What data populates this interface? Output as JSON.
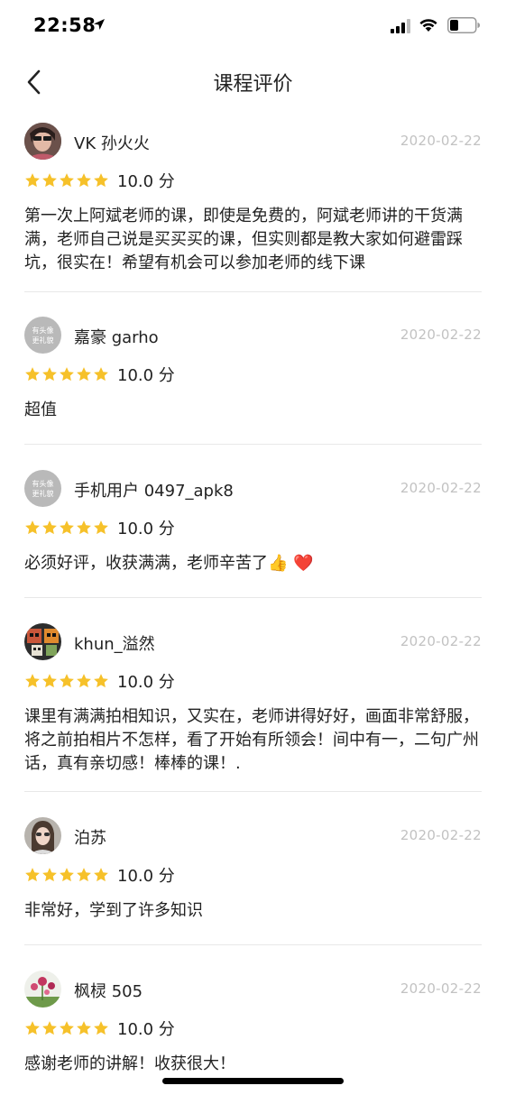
{
  "status_bar": {
    "time": "22:58"
  },
  "nav": {
    "title": "课程评价"
  },
  "reviews": [
    {
      "username": "VK 孙火火",
      "date": "2020-02-22",
      "score": "10.0 分",
      "stars": 5,
      "content": "第一次上阿斌老师的课，即使是免费的，阿斌老师讲的干货满满，老师自己说是买买买的课，但实则都是教大家如何避雷踩坑，很实在！希望有机会可以参加老师的线下课"
    },
    {
      "username": "嘉豪 garho",
      "date": "2020-02-22",
      "score": "10.0 分",
      "stars": 5,
      "avatar_text": [
        "有头像",
        "更礼貌"
      ],
      "content": "超值"
    },
    {
      "username": "手机用户 0497_apk8",
      "date": "2020-02-22",
      "score": "10.0 分",
      "stars": 5,
      "avatar_text": [
        "有头像",
        "更礼貌"
      ],
      "content": "必须好评，收获满满，老师辛苦了👍 ❤️"
    },
    {
      "username": "khun_溢然",
      "date": "2020-02-22",
      "score": "10.0 分",
      "stars": 5,
      "content": "课里有满满拍相知识，又实在，老师讲得好好，画面非常舒服，将之前拍相片不怎样，看了开始有所领会！间中有一，二句广州话，真有亲切感！棒棒的课！."
    },
    {
      "username": "泊苏",
      "date": "2020-02-22",
      "score": "10.0 分",
      "stars": 5,
      "content": "非常好，学到了许多知识"
    },
    {
      "username": "枫棂 505",
      "date": "2020-02-22",
      "score": "10.0 分",
      "stars": 5,
      "content": "感谢老师的讲解！收获很大！"
    }
  ],
  "colors": {
    "star": "#f6c12a",
    "date": "#c2c2c2",
    "divider": "#e8e8e8"
  }
}
